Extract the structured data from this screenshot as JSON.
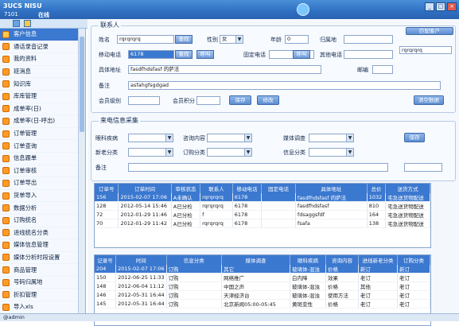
{
  "app": {
    "title": "3UCS NISU",
    "user_id": "7101",
    "status": "在线",
    "status_bar_user": "@admin"
  },
  "window_buttons": [
    "_",
    "□",
    "×"
  ],
  "sidebar": {
    "items": [
      {
        "label": "客户信息",
        "active": true
      },
      {
        "label": "通话录音记录"
      },
      {
        "label": "我的资料"
      },
      {
        "label": "班消息"
      },
      {
        "label": "知识库"
      },
      {
        "label": "库库管理"
      },
      {
        "label": "成单率(日)"
      },
      {
        "label": "成单率(日-呼出)"
      },
      {
        "label": "订单管理"
      },
      {
        "label": "订单查询"
      },
      {
        "label": "信息跟单"
      },
      {
        "label": "订单审核"
      },
      {
        "label": "订单导出"
      },
      {
        "label": "货单导入"
      },
      {
        "label": "数据分析"
      },
      {
        "label": "订购统名"
      },
      {
        "label": "进线统名分类"
      },
      {
        "label": "媒体信息管理"
      },
      {
        "label": "媒体分析时段设置"
      },
      {
        "label": "商品管理"
      },
      {
        "label": "号码归属地"
      },
      {
        "label": "折扣管理"
      },
      {
        "label": "导入xls"
      }
    ]
  },
  "contact": {
    "section_title": "联系人",
    "name_label": "姓名",
    "name_value": "rqrqrqrq",
    "search_label": "查找",
    "gender_label": "性别",
    "gender_value": "女",
    "age_label": "年龄",
    "age_value": "0",
    "region_label": "归属地",
    "region_value": "",
    "mobile_label": "移动电话",
    "mobile_value": "6178",
    "mobile_search": "查找",
    "mobile_call": "呼叫",
    "fixed_label": "固定电话",
    "fixed_value": "",
    "fixed_call": "呼叫",
    "other_label": "其他电话",
    "other_value": "",
    "address_label": "具体地址",
    "address_value": "fasdfhdsfasf 的萨法",
    "postcode_label": "邮编",
    "postcode_value": "",
    "remark_label": "备注",
    "remark_value": "asfahgfsgdgad",
    "level_label": "会员级别",
    "level_value": "",
    "points_label": "会员积分",
    "points_value": "",
    "save_label": "保存",
    "modify_label": "修改",
    "clear_label": "清空数据",
    "match_label": "匹配客户",
    "match_value": "rqrqrqrq"
  },
  "collection": {
    "section_title": "来电信息采集",
    "disease_label": "眼科疾病",
    "disease_value": "",
    "consult_label": "咨询内容",
    "consult_value": "",
    "media_label": "媒体调查",
    "media_value": "",
    "newold_label": "新老分类",
    "newold_value": "",
    "order_label": "订购分类",
    "order_value": "",
    "info_label": "信息分类",
    "info_value": "",
    "remark_label": "备注",
    "remark_value": "",
    "save_label": "保存"
  },
  "orders_table": {
    "headers": [
      "订单号",
      "订单时间",
      "审核状态",
      "联系人",
      "移动电话",
      "固定电话",
      "具体地址",
      "总价",
      "送货方式"
    ],
    "rows": [
      [
        "156",
        "2015-02-07 17:06",
        "A未确认",
        "rqrqrqrq",
        "6178",
        "",
        "fasdfhdsfasf 的萨法",
        "1032",
        "宅急送货物配送"
      ],
      [
        "128",
        "2012-05-14 15:46",
        "A已分检",
        "rqrqrqrq",
        "6178",
        "",
        "fasdfhdsfasf",
        "810",
        "宅急送货物配送"
      ],
      [
        "72",
        "2012-01-29 11:46",
        "A已分检",
        "f",
        "6178",
        "",
        "fdsaggsfdf",
        "164",
        "宅急送货物配送"
      ],
      [
        "70",
        "2012-01-29 11:42",
        "A已分检",
        "rqrqrqrq",
        "6178",
        "",
        "fsafa",
        "138",
        "宅急送货物配送"
      ]
    ]
  },
  "records_table": {
    "headers": [
      "记录号",
      "时间",
      "信息分类",
      "媒体调查",
      "眼科疾病",
      "咨询内容",
      "进线新老分类",
      "订购分类"
    ],
    "rows": [
      [
        "204",
        "2015-02-07 17:06",
        "订购",
        "其它",
        "玻璃体-混浊",
        "价格",
        "新订",
        "新订"
      ],
      [
        "150",
        "2012-06-25 11:33",
        "订购",
        "网络推广",
        "白内障",
        "效果",
        "老订",
        "老订"
      ],
      [
        "148",
        "2012-06-04 11:12",
        "订购",
        "中国之声",
        "玻璃体-混浊",
        "价格",
        "其他",
        "老订"
      ],
      [
        "146",
        "2012-05-31 16:44",
        "订购",
        "天津经济台",
        "玻璃体-混浊",
        "使用方法",
        "老订",
        "老订"
      ],
      [
        "145",
        "2012-05-31 16:44",
        "订购",
        "北京新闻05:00-05:45",
        "黄斑变性",
        "价格",
        "老订",
        "老订"
      ]
    ]
  }
}
